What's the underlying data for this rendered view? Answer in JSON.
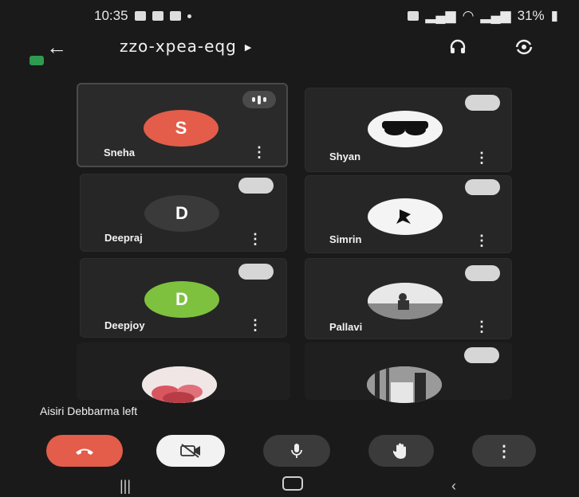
{
  "status": {
    "time": "10:35",
    "battery": "31%"
  },
  "meeting": {
    "code": "zzo-xpea-eqg"
  },
  "participants": [
    {
      "name": "Sneha",
      "initial": "S",
      "color": "#e35d4a"
    },
    {
      "name": "Shyan"
    },
    {
      "name": "Deepraj",
      "initial": "D",
      "color": "#3a3a3a"
    },
    {
      "name": "Simrin"
    },
    {
      "name": "Deepjoy",
      "initial": "D",
      "color": "#7ec13f"
    },
    {
      "name": "Pallavi"
    }
  ],
  "notification": {
    "text": "Aisiri Debbarma left"
  },
  "controls": [
    "end-call",
    "camera-off",
    "microphone",
    "raise-hand",
    "more-options"
  ],
  "colors": {
    "end_call": "#e35d4a",
    "background": "#1a1a1a"
  }
}
